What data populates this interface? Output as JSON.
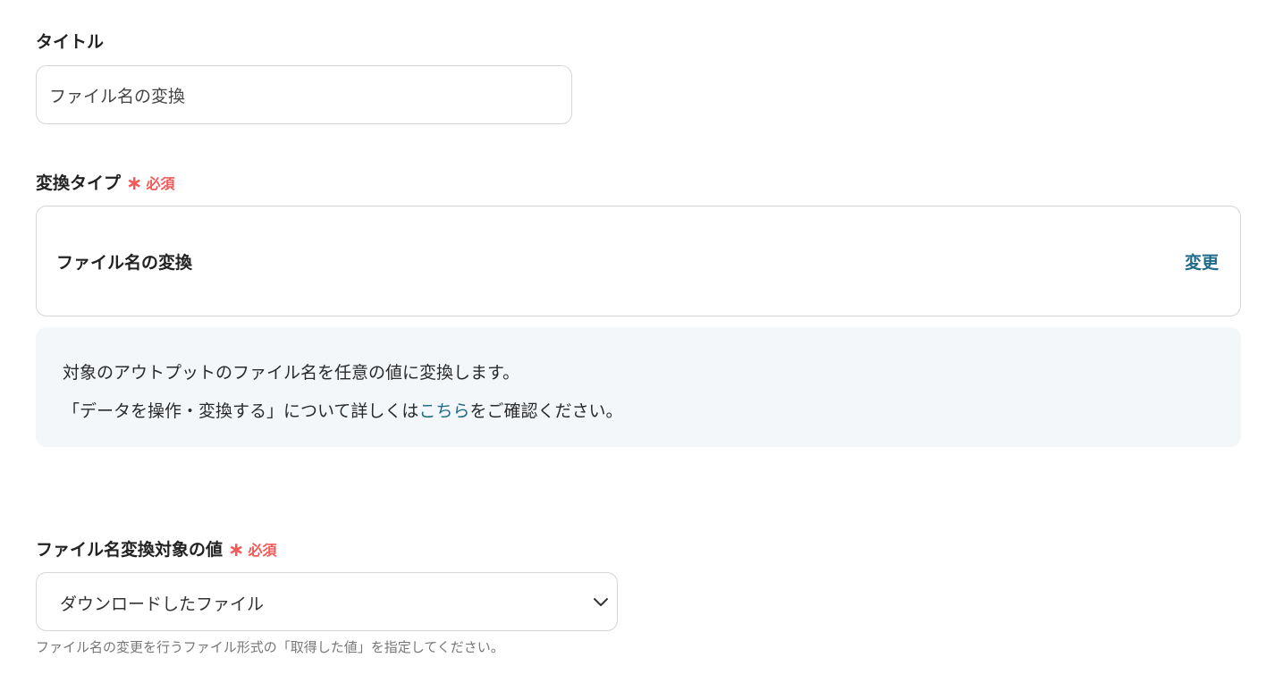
{
  "title_field": {
    "label": "タイトル",
    "value": "ファイル名の変換"
  },
  "conversion_type": {
    "label": "変換タイプ",
    "required_label": "必須",
    "value": "ファイル名の変換",
    "change_label": "変更"
  },
  "info": {
    "line1": "対象のアウトプットのファイル名を任意の値に変換します。",
    "line2_before": "「データを操作・変換する」について詳しくは",
    "line2_link": "こちら",
    "line2_after": "をご確認ください。"
  },
  "target_value": {
    "label": "ファイル名変換対象の値",
    "required_label": "必須",
    "selected": "ダウンロードしたファイル",
    "hint": "ファイル名の変更を行うファイル形式の「取得した値」を指定してください。"
  },
  "icons": {
    "required_marker": "asterisk",
    "dropdown": "chevron-down-icon"
  },
  "colors": {
    "required": "#f05a5a",
    "link": "#1f6b8a",
    "info_bg": "#f4f7fa",
    "border": "#d4d6da"
  }
}
